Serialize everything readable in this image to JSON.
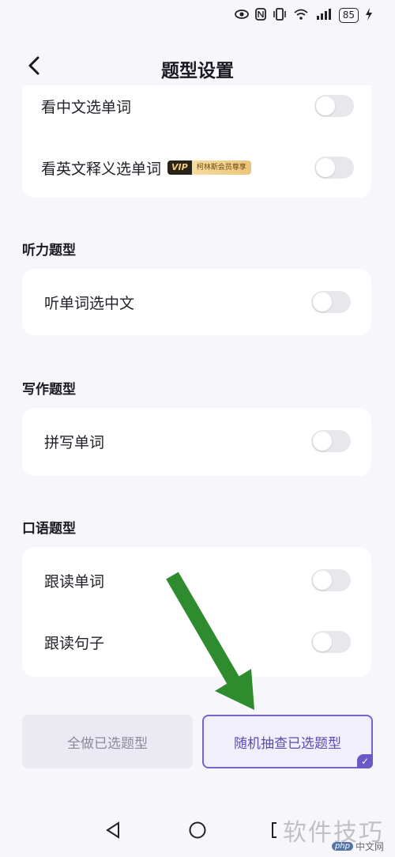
{
  "status_bar": {
    "battery": "85"
  },
  "header": {
    "title": "题型设置"
  },
  "section_reading": {
    "items": [
      {
        "label": "看中文选单词",
        "enabled": false
      },
      {
        "label": "看英文释义选单词",
        "enabled": false,
        "badge_tag": "VIP",
        "badge_text": "柯林斯会员尊享"
      }
    ]
  },
  "section_listening": {
    "title": "听力题型",
    "items": [
      {
        "label": "听单词选中文",
        "enabled": false
      }
    ]
  },
  "section_writing": {
    "title": "写作题型",
    "items": [
      {
        "label": "拼写单词",
        "enabled": false
      }
    ]
  },
  "section_speaking": {
    "title": "口语题型",
    "items": [
      {
        "label": "跟读单词",
        "enabled": false
      },
      {
        "label": "跟读句子",
        "enabled": false
      }
    ]
  },
  "buttons": {
    "all_label": "全做已选题型",
    "random_label": "随机抽查已选题型",
    "selected": "random"
  },
  "watermark": {
    "text": "软件技巧",
    "site": "中文网",
    "site_tag": "php"
  },
  "colors": {
    "accent": "#6a5ac6",
    "arrow": "#2e8b2e",
    "background": "#f7f6fb"
  },
  "icons": {
    "back": "chevron-left-icon",
    "nav_back": "triangle-back-icon",
    "nav_home": "circle-home-icon",
    "nav_recent": "square-recent-icon"
  }
}
